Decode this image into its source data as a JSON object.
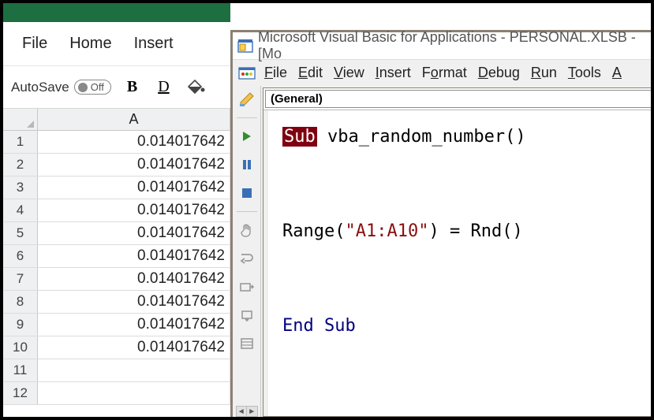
{
  "excel": {
    "menus": {
      "file": "File",
      "home": "Home",
      "insert": "Insert"
    },
    "autosave": {
      "label": "AutoSave",
      "state": "Off"
    },
    "col_header": "A",
    "rows": [
      {
        "n": "1",
        "v": "0.014017642"
      },
      {
        "n": "2",
        "v": "0.014017642"
      },
      {
        "n": "3",
        "v": "0.014017642"
      },
      {
        "n": "4",
        "v": "0.014017642"
      },
      {
        "n": "5",
        "v": "0.014017642"
      },
      {
        "n": "6",
        "v": "0.014017642"
      },
      {
        "n": "7",
        "v": "0.014017642"
      },
      {
        "n": "8",
        "v": "0.014017642"
      },
      {
        "n": "9",
        "v": "0.014017642"
      },
      {
        "n": "10",
        "v": "0.014017642"
      },
      {
        "n": "11",
        "v": ""
      },
      {
        "n": "12",
        "v": ""
      }
    ]
  },
  "vbe": {
    "title": "Microsoft Visual Basic for Applications - PERSONAL.XLSB - [Mo",
    "menus": {
      "file": "File",
      "edit": "Edit",
      "view": "View",
      "insert": "Insert",
      "format": "Format",
      "debug": "Debug",
      "run": "Run",
      "tools": "Tools",
      "addins": "A"
    },
    "dropdown": "(General)",
    "code": {
      "kw_sub": "Sub",
      "proc_name": " vba_random_number",
      "parens1": "()",
      "range_call": "Range",
      "open_p": "(",
      "range_arg": "\"A1:A10\"",
      "close_p": ")",
      "eq": " = ",
      "rnd": "Rnd",
      "parens2": "()",
      "kw_end": "End",
      "kw_sub2": " Sub"
    }
  }
}
